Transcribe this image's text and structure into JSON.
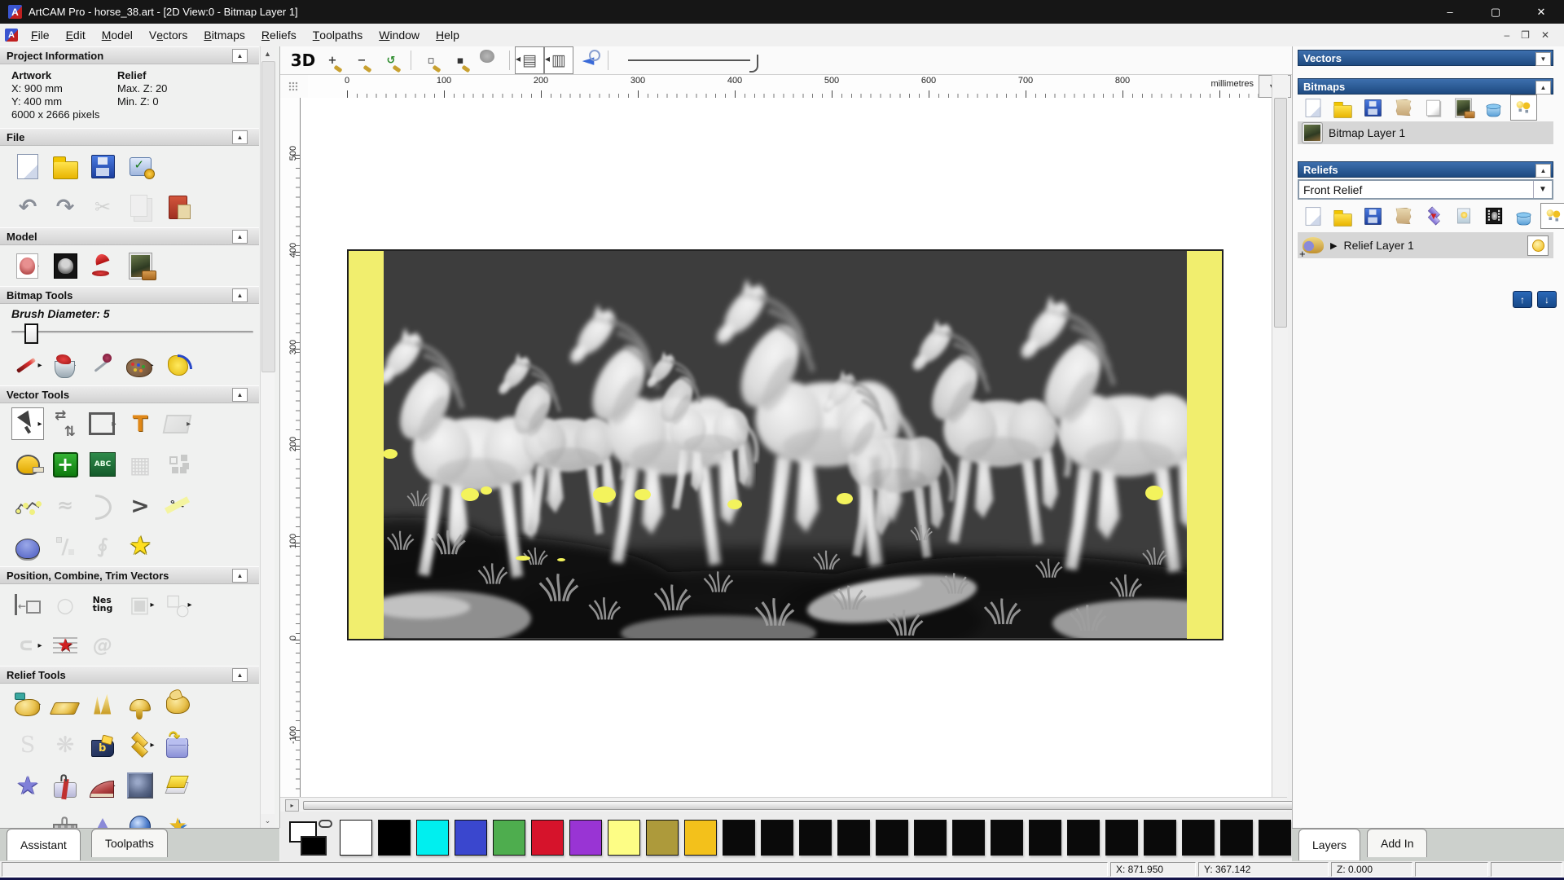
{
  "window": {
    "title": "ArtCAM Pro - horse_38.art - [2D View:0 - Bitmap Layer 1]",
    "minimize": "–",
    "maximize": "▢",
    "close": "✕",
    "logo": "A"
  },
  "menu": {
    "items": [
      {
        "label": "File",
        "u": 0
      },
      {
        "label": "Edit",
        "u": 0
      },
      {
        "label": "Model",
        "u": 0
      },
      {
        "label": "Vectors",
        "u": 1
      },
      {
        "label": "Bitmaps",
        "u": 0
      },
      {
        "label": "Reliefs",
        "u": 0
      },
      {
        "label": "Toolpaths",
        "u": 0
      },
      {
        "label": "Window",
        "u": 0
      },
      {
        "label": "Help",
        "u": 0
      }
    ],
    "mdi": {
      "minimize": "–",
      "restore": "❐",
      "close": "✕"
    }
  },
  "project_info": {
    "header": "Project Information",
    "col1": "Artwork",
    "col2": "Relief",
    "x": "X: 900 mm",
    "y": "Y: 400 mm",
    "maxz": "Max. Z: 20",
    "minz": "Min. Z: 0",
    "pixels": "6000 x 2666 pixels"
  },
  "left_panel": {
    "sections": [
      {
        "label": "File",
        "rows": [
          [
            {
              "n": "new-model",
              "k": "doc"
            },
            {
              "n": "open-model",
              "k": "folder"
            },
            {
              "n": "save-model",
              "k": "floppy"
            },
            {
              "n": "model-properties",
              "k": "monitor"
            }
          ],
          [
            {
              "n": "undo",
              "k": "undo",
              "g": "↶"
            },
            {
              "n": "redo",
              "k": "redo",
              "g": "↷"
            },
            {
              "n": "cut",
              "k": "cut",
              "g": "✂",
              "dis": 1
            },
            {
              "n": "copy",
              "k": "copy",
              "dis": 1
            },
            {
              "n": "paste",
              "k": "paste"
            }
          ]
        ]
      },
      {
        "label": "Model",
        "rows": [
          [
            {
              "n": "set-model-size",
              "k": "bear",
              "arr": 1
            },
            {
              "n": "greyscale-view",
              "k": "beardark"
            },
            {
              "n": "lighting-setup",
              "k": "lamp"
            },
            {
              "n": "load-image",
              "k": "mona"
            }
          ]
        ]
      },
      {
        "label": "Bitmap Tools",
        "brush": {
          "label": "Brush Diameter:",
          "value": "5"
        },
        "rows": [
          [
            {
              "n": "paint-tool",
              "k": "pencil",
              "arr": 1
            },
            {
              "n": "flood-fill",
              "k": "bucket",
              "arr": 1
            },
            {
              "n": "pick-colour",
              "k": "dropper"
            },
            {
              "n": "colour-palette",
              "k": "palette",
              "arr": 1
            },
            {
              "n": "magic-wand",
              "k": "wand"
            }
          ]
        ]
      },
      {
        "label": "Vector Tools",
        "rows": [
          [
            {
              "n": "select-vectors",
              "k": "cursor",
              "pr": 1,
              "arr": 1
            },
            {
              "n": "transform-vectors",
              "k": "transform"
            },
            {
              "n": "create-rectangle",
              "k": "rect",
              "arr": 1
            },
            {
              "n": "create-text",
              "k": "textT",
              "g": "T"
            },
            {
              "n": "envelope-distortion",
              "k": "envelope",
              "dis": 1,
              "arr": 1
            }
          ],
          [
            {
              "n": "measure-tool",
              "k": "tape"
            },
            {
              "n": "create-shape",
              "k": "plus",
              "g": "+"
            },
            {
              "n": "text-tools",
              "k": "abc",
              "g": "ABC"
            },
            {
              "n": "distort-grid",
              "k": "wiregrid",
              "g": "▦",
              "dis": 1
            },
            {
              "n": "block-paste",
              "k": "dots",
              "dis": 1
            }
          ],
          [
            {
              "n": "create-polyline",
              "k": "polyline"
            },
            {
              "n": "freehand-draw",
              "k": "freehand",
              "g": "≈",
              "dis": 1
            },
            {
              "n": "create-arc",
              "k": "arc",
              "dis": 1
            },
            {
              "n": "fillet-bevel",
              "k": "bevel",
              "g": ">"
            },
            {
              "n": "trim-vectors",
              "k": "trim",
              "g": "✂"
            }
          ],
          [
            {
              "n": "vector-doctor",
              "k": "dome"
            },
            {
              "n": "node-editing",
              "k": "node",
              "dis": 1
            },
            {
              "n": "mirror-vectors",
              "k": "halfarc",
              "g": "∮",
              "dis": 1
            },
            {
              "n": "create-star",
              "k": "star",
              "g": "★"
            }
          ]
        ]
      },
      {
        "label": "Position, Combine, Trim Vectors",
        "rows": [
          [
            {
              "n": "align-vectors",
              "k": "align",
              "arr": 1
            },
            {
              "n": "text-on-curve",
              "k": "textcircle",
              "g": "○",
              "dis": 1
            },
            {
              "n": "nesting",
              "k": "nesting",
              "g": "Nes\nting"
            },
            {
              "n": "group-vectors",
              "k": "group",
              "g": "▣",
              "dis": 1,
              "arr": 1
            },
            {
              "n": "weld-vectors",
              "k": "weld",
              "dis": 1,
              "arr": 1
            }
          ],
          [
            {
              "n": "join-vectors",
              "k": "join",
              "g": "∪",
              "dis": 1,
              "arr": 1
            },
            {
              "n": "fit-vectors-to-curves",
              "k": "fitstar",
              "g": "★"
            },
            {
              "n": "create-spiral",
              "k": "spiral",
              "g": "@",
              "dis": 1
            }
          ]
        ]
      },
      {
        "label": "Relief Tools",
        "rows": [
          [
            {
              "n": "sculpting",
              "k": "sculpt gold",
              "arr": 1
            },
            {
              "n": "shape-editor",
              "k": "ingot gold",
              "arr": 1
            },
            {
              "n": "smooth-relief",
              "k": "spikes gold"
            },
            {
              "n": "dome-relief",
              "k": "mushroom gold"
            },
            {
              "n": "two-rail-sweep",
              "k": "bird gold"
            }
          ],
          [
            {
              "n": "swept-profile",
              "k": "sletter",
              "g": "S",
              "dis": 1
            },
            {
              "n": "weave-wizard",
              "k": "weave",
              "g": "❋",
              "dis": 1
            },
            {
              "n": "face-wizard",
              "k": "bookblue"
            },
            {
              "n": "relief-layers",
              "k": "rlayers",
              "arr": 1
            },
            {
              "n": "load-relief",
              "k": "bag",
              "arr": 1
            }
          ],
          [
            {
              "n": "texture-star",
              "k": "bstar",
              "g": "★"
            },
            {
              "n": "wrap-relief",
              "k": "wrap"
            },
            {
              "n": "shape-wedge",
              "k": "wedge",
              "arr": 1
            },
            {
              "n": "emboss-texture",
              "k": "texsq"
            },
            {
              "n": "offset-relief",
              "k": "ystack"
            }
          ],
          [
            {
              "n": "red-relief-tool",
              "k": "redblob"
            },
            {
              "n": "basket-weave",
              "k": "basket"
            },
            {
              "n": "extrude-tool",
              "k": "cone"
            },
            {
              "n": "spin-tool",
              "k": "sphereblue"
            },
            {
              "n": "flower-tool",
              "k": "flower",
              "g": "★"
            }
          ]
        ]
      }
    ],
    "tabs": [
      {
        "label": "Assistant",
        "active": true
      },
      {
        "label": "Toolpaths",
        "active": false
      }
    ]
  },
  "canvas_toolbar": {
    "items": [
      {
        "n": "view-3d",
        "k": "t3d",
        "g": "3D"
      },
      {
        "n": "zoom-in",
        "k": "mag",
        "g": "+"
      },
      {
        "n": "zoom-out",
        "k": "mag",
        "g": "−"
      },
      {
        "n": "zoom-previous",
        "k": "magg",
        "g": "↺"
      },
      {
        "sep": 1
      },
      {
        "n": "zoom-box",
        "k": "mag",
        "g": "▫"
      },
      {
        "n": "zoom-object",
        "k": "mag",
        "g": "▪"
      },
      {
        "n": "zoom-extents",
        "k": "magblob"
      },
      {
        "sep": 1
      },
      {
        "n": "snap-grid-toggle",
        "k": "tog",
        "g": "▤",
        "pr": 1
      },
      {
        "n": "snap-guides-toggle",
        "k": "tog",
        "g": "▥",
        "pr": 1
      },
      {
        "n": "pan-view",
        "k": "panmag",
        "g": "◄"
      },
      {
        "sep": 1
      },
      {
        "slider": 1
      }
    ]
  },
  "ruler": {
    "unit": "millimetres",
    "h_labels": [
      0,
      100,
      200,
      300,
      400,
      500,
      600,
      700,
      800
    ],
    "v_labels": [
      500,
      400,
      300,
      200,
      100,
      0,
      -100
    ]
  },
  "right_panel": {
    "vectors": {
      "title": "Vectors"
    },
    "bitmaps": {
      "title": "Bitmaps",
      "tools": [
        {
          "n": "new-bitmap-layer",
          "k": "doc"
        },
        {
          "n": "open-bitmap-layer",
          "k": "folder"
        },
        {
          "n": "save-bitmap-layer",
          "k": "floppy"
        },
        {
          "n": "merge-bitmap-layers",
          "k": "scroll"
        },
        {
          "n": "blank-bitmap",
          "k": "graypage"
        },
        {
          "n": "bitmap-to-vector",
          "k": "mona"
        },
        {
          "n": "delete-bitmap-layer",
          "k": "bucketblue"
        },
        {
          "n": "toggle-all-bitmap-visibility",
          "k": "bulbs",
          "pr": 1
        }
      ],
      "layer": {
        "name": "Bitmap Layer 1"
      }
    },
    "reliefs": {
      "title": "Reliefs",
      "combo_value": "Front Relief",
      "tools": [
        {
          "n": "new-relief-layer",
          "k": "doc"
        },
        {
          "n": "open-relief-layer",
          "k": "folder"
        },
        {
          "n": "save-relief-layer",
          "k": "floppy"
        },
        {
          "n": "merge-relief-layers",
          "k": "scroll"
        },
        {
          "n": "transfer-relief",
          "k": "purlayers",
          "g": "▼"
        },
        {
          "n": "layer-visibility-page",
          "k": "bulbpage"
        },
        {
          "n": "greyscale-from-relief",
          "k": "film"
        },
        {
          "n": "delete-relief-layer",
          "k": "bucketblue"
        },
        {
          "n": "toggle-all-relief-visibility",
          "k": "bulbs",
          "pr": 1
        }
      ],
      "layer": {
        "name": "Relief Layer 1",
        "expand": "▶"
      },
      "move_up": "↑",
      "move_down": "↓"
    },
    "tabs": [
      {
        "label": "Layers",
        "active": true
      },
      {
        "label": "Add In",
        "active": false
      }
    ]
  },
  "palette": {
    "colors": [
      "#ffffff",
      "#000000",
      "#00efef",
      "#3a47ce",
      "#4ead4e",
      "#d6132b",
      "#9934d4",
      "#fdfd85",
      "#ad9a3b",
      "#f3c11b",
      "#0a0a0a",
      "#0a0a0a",
      "#0a0a0a",
      "#0a0a0a",
      "#0a0a0a",
      "#0a0a0a",
      "#0a0a0a",
      "#0a0a0a",
      "#0a0a0a",
      "#0a0a0a",
      "#0a0a0a",
      "#0a0a0a",
      "#0a0a0a",
      "#0a0a0a",
      "#0a0a0a"
    ]
  },
  "status": {
    "x": "X: 871.950",
    "y": "Y: 367.142",
    "z": "Z: 0.000"
  }
}
